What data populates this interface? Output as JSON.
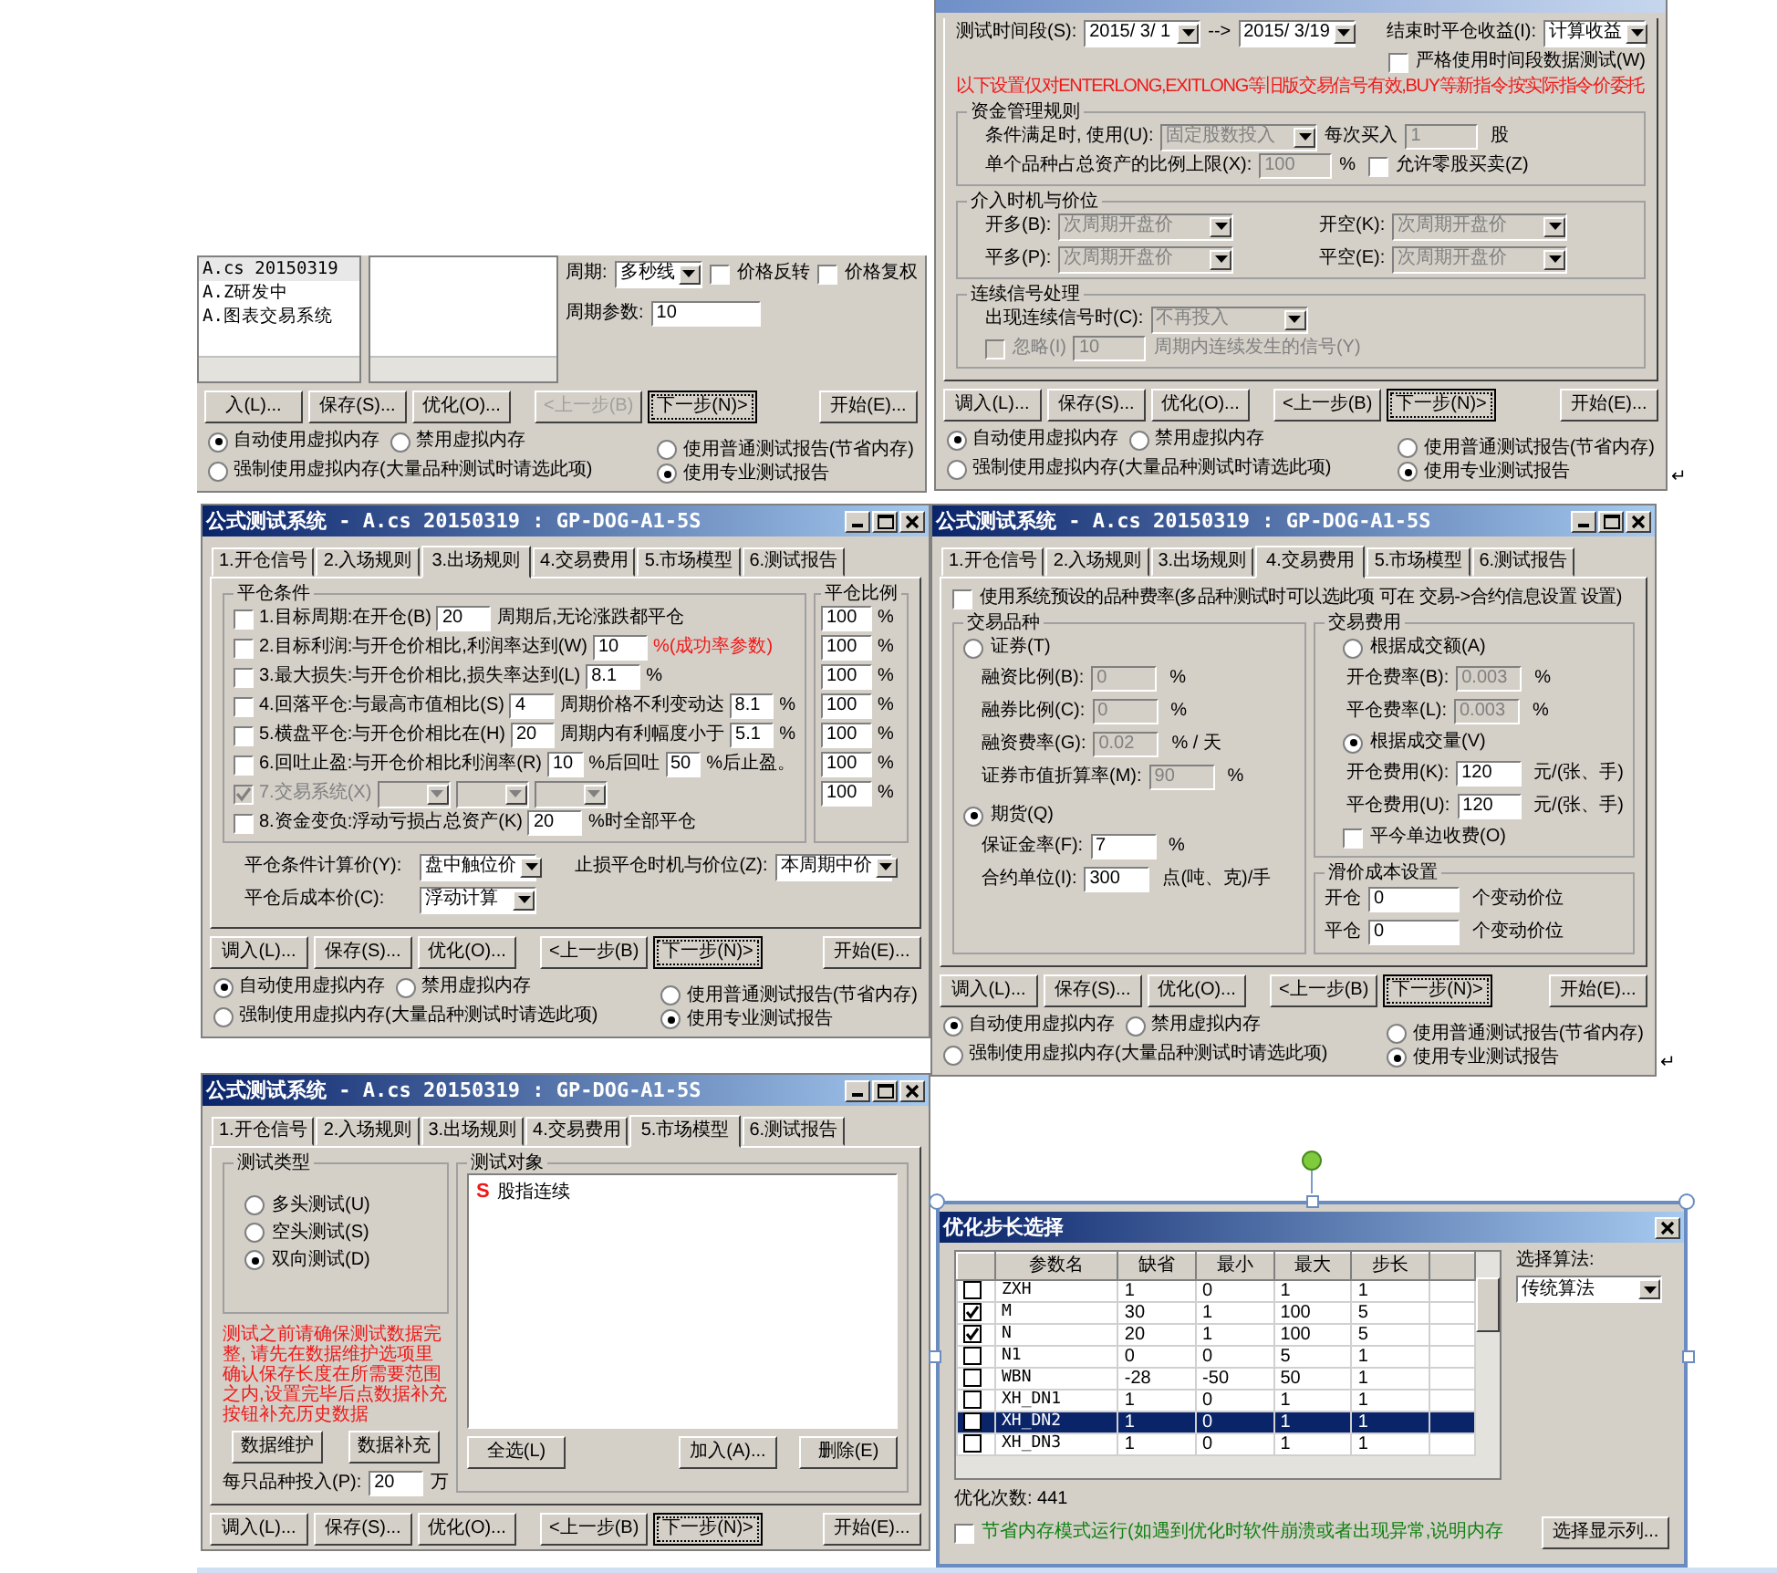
{
  "windows": [
    {
      "kind": "signal",
      "formula_list": [
        {
          "label": "A.cs 20150319",
          "selected": true
        },
        {
          "label": "A.Z研发中",
          "selected": false
        },
        {
          "label": "A.图表交易系统",
          "selected": false
        }
      ],
      "period": {
        "label": "周期:",
        "value": "多秒线"
      },
      "options": [
        {
          "label": "价格反转",
          "checked": false
        },
        {
          "label": "价格复权",
          "checked": false
        }
      ],
      "period_param": {
        "label": "周期参数:",
        "value": "10"
      },
      "buttons": [
        {
          "label": "入(L)...",
          "disabled": false,
          "focused": false
        },
        {
          "label": "保存(S)...",
          "disabled": false,
          "focused": false
        },
        {
          "label": "优化(O)...",
          "disabled": false,
          "focused": false
        },
        {
          "label": "<上一步(B)",
          "disabled": true,
          "focused": false
        },
        {
          "label": "下一步(N)>",
          "disabled": false,
          "focused": true
        },
        {
          "label": "开始(E)...",
          "disabled": false,
          "focused": false
        }
      ],
      "memory_options": [
        {
          "label": "自动使用虚拟内存",
          "selected": true
        },
        {
          "label": "禁用虚拟内存",
          "selected": false
        },
        {
          "label": "强制使用虚拟内存(大量品种测试时请选此项)",
          "selected": false
        }
      ],
      "report_options": [
        {
          "label": "使用普通测试报告(节省内存)",
          "selected": false
        },
        {
          "label": "使用专业测试报告",
          "selected": true
        }
      ]
    },
    {
      "kind": "entry",
      "test_period": {
        "label": "测试时间段(S):",
        "from": "2015/ 3/ 1",
        "separator": "-->",
        "to": "2015/ 3/19"
      },
      "close_profit": {
        "label": "结束时平仓收益(I):",
        "value": "计算收益"
      },
      "strict_option": {
        "label": "严格使用时间段数据测试(W)",
        "checked": false
      },
      "notice": "以下设置仅对ENTERLONG,EXITLONG等旧版交易信号有效,BUY等新指令按实际指令价委托",
      "money_rules": {
        "title": "资金管理规则",
        "disabled": true,
        "use_label": "条件满足时, 使用(U):",
        "use_value": "固定股数投入",
        "buy_label": "每次买入",
        "buy_value": "1",
        "buy_unit": "股",
        "ratio_label": "单个品种占总资产的比例上限(X):",
        "ratio_value": "100",
        "ratio_unit": "%",
        "odd_lot": {
          "label": "允许零股买卖(Z)",
          "checked": false
        }
      },
      "timing": {
        "title": "介入时机与价位",
        "disabled": true,
        "items": [
          {
            "label": "开多(B):",
            "value": "次周期开盘价"
          },
          {
            "label": "开空(K):",
            "value": "次周期开盘价"
          },
          {
            "label": "平多(P):",
            "value": "次周期开盘价"
          },
          {
            "label": "平空(E):",
            "value": "次周期开盘价"
          }
        ]
      },
      "consecutive": {
        "title": "连续信号处理",
        "disabled": true,
        "label": "出现连续信号时(C):",
        "value": "不再投入",
        "ignore": {
          "label": "忽略(I)",
          "checked": false
        },
        "periods": "10",
        "suffix": "周期内连续发生的信号(Y)"
      },
      "buttons": [
        {
          "label": "调入(L)...",
          "disabled": false,
          "focused": false
        },
        {
          "label": "保存(S)...",
          "disabled": false,
          "focused": false
        },
        {
          "label": "优化(O)...",
          "disabled": false,
          "focused": false
        },
        {
          "label": "<上一步(B)",
          "disabled": false,
          "focused": false
        },
        {
          "label": "下一步(N)>",
          "disabled": false,
          "focused": true
        },
        {
          "label": "开始(E)...",
          "disabled": false,
          "focused": false
        }
      ],
      "memory_options": [
        {
          "label": "自动使用虚拟内存",
          "selected": true
        },
        {
          "label": "禁用虚拟内存",
          "selected": false
        },
        {
          "label": "强制使用虚拟内存(大量品种测试时请选此项)",
          "selected": false
        }
      ],
      "report_options": [
        {
          "label": "使用普通测试报告(节省内存)",
          "selected": false
        },
        {
          "label": "使用专业测试报告",
          "selected": true
        }
      ],
      "end_mark": "↵"
    },
    {
      "kind": "exit",
      "title": "公式测试系统 - A.cs 20150319 : GP-DOG-A1-5S",
      "tabs": [
        {
          "label": "1.开仓信号",
          "selected": false
        },
        {
          "label": "2.入场规则",
          "selected": false
        },
        {
          "label": "3.出场规则",
          "selected": true
        },
        {
          "label": "4.交易费用",
          "selected": false
        },
        {
          "label": "5.市场模型",
          "selected": false
        },
        {
          "label": "6.测试报告",
          "selected": false
        }
      ],
      "close_conditions": {
        "title": "平仓条件",
        "rows": [
          {
            "checked": false,
            "disabled": false,
            "parts": [
              {
                "kind": "text",
                "text": "1.目标周期:在开仓(B)"
              },
              {
                "kind": "field",
                "value": "20"
              },
              {
                "kind": "text",
                "text": "周期后,无论涨跌都平仓"
              }
            ]
          },
          {
            "checked": false,
            "disabled": false,
            "parts": [
              {
                "kind": "text",
                "text": "2.目标利润:与开仓价相比,利润率达到(W)"
              },
              {
                "kind": "field",
                "value": "10"
              },
              {
                "kind": "warning",
                "text": "%(成功率参数)"
              }
            ]
          },
          {
            "checked": false,
            "disabled": false,
            "parts": [
              {
                "kind": "text",
                "text": "3.最大损失:与开仓价相比,损失率达到(L)"
              },
              {
                "kind": "field",
                "value": "8.1"
              },
              {
                "kind": "text",
                "text": "%"
              }
            ]
          },
          {
            "checked": false,
            "disabled": false,
            "parts": [
              {
                "kind": "text",
                "text": "4.回落平仓:与最高市值相比(S)"
              },
              {
                "kind": "field",
                "value": "4"
              },
              {
                "kind": "text",
                "text": "周期价格不利变动达"
              },
              {
                "kind": "field",
                "value": "8.1"
              },
              {
                "kind": "text",
                "text": "%"
              }
            ]
          },
          {
            "checked": false,
            "disabled": false,
            "parts": [
              {
                "kind": "text",
                "text": "5.横盘平仓:与开仓价相比在(H)"
              },
              {
                "kind": "field",
                "value": "20"
              },
              {
                "kind": "text",
                "text": "周期内有利幅度小于"
              },
              {
                "kind": "field",
                "value": "5.1"
              },
              {
                "kind": "text",
                "text": "%"
              }
            ]
          },
          {
            "checked": false,
            "disabled": false,
            "parts": [
              {
                "kind": "text",
                "text": "6.回吐止盈:与开仓价相比利润率(R)"
              },
              {
                "kind": "field",
                "value": "10"
              },
              {
                "kind": "text",
                "text": "%后回吐"
              },
              {
                "kind": "field",
                "value": "50"
              },
              {
                "kind": "text",
                "text": "%后止盈。"
              }
            ]
          },
          {
            "checked": true,
            "disabled": true,
            "parts": [
              {
                "kind": "text",
                "text": "7.交易系统(X)"
              },
              {
                "kind": "dropdown"
              },
              {
                "kind": "dropdown"
              },
              {
                "kind": "dropdown"
              }
            ]
          },
          {
            "checked": false,
            "disabled": false,
            "parts": [
              {
                "kind": "text",
                "text": "8.资金变负:浮动亏损占总资产(K)"
              },
              {
                "kind": "field",
                "value": "20"
              },
              {
                "kind": "text",
                "text": "%时全部平仓"
              }
            ]
          }
        ]
      },
      "close_ratio": {
        "title": "平仓比例",
        "items": [
          {
            "value": "100",
            "unit": "%"
          },
          {
            "value": "100",
            "unit": "%"
          },
          {
            "value": "100",
            "unit": "%"
          },
          {
            "value": "100",
            "unit": "%"
          },
          {
            "value": "100",
            "unit": "%"
          },
          {
            "value": "100",
            "unit": "%"
          },
          {
            "value": "100",
            "unit": "%"
          }
        ]
      },
      "price_settings": [
        {
          "label": "平仓条件计算价(Y):",
          "value": "盘中触位价"
        },
        {
          "label": "止损平仓时机与价位(Z):",
          "value": "本周期中价"
        },
        {
          "label": "平仓后成本价(C):",
          "value": "浮动计算"
        }
      ],
      "buttons": [
        {
          "label": "调入(L)...",
          "disabled": false,
          "focused": false
        },
        {
          "label": "保存(S)...",
          "disabled": false,
          "focused": false
        },
        {
          "label": "优化(O)...",
          "disabled": false,
          "focused": false
        },
        {
          "label": "<上一步(B)",
          "disabled": false,
          "focused": false
        },
        {
          "label": "下一步(N)>",
          "disabled": false,
          "focused": true
        },
        {
          "label": "开始(E)...",
          "disabled": false,
          "focused": false
        }
      ],
      "memory_options": [
        {
          "label": "自动使用虚拟内存",
          "selected": true
        },
        {
          "label": "禁用虚拟内存",
          "selected": false
        },
        {
          "label": "强制使用虚拟内存(大量品种测试时请选此项)",
          "selected": false
        }
      ],
      "report_options": [
        {
          "label": "使用普通测试报告(节省内存)",
          "selected": false
        },
        {
          "label": "使用专业测试报告",
          "selected": true
        }
      ]
    },
    {
      "kind": "fees",
      "title": "公式测试系统 - A.cs 20150319 : GP-DOG-A1-5S",
      "tabs": [
        {
          "label": "1.开仓信号",
          "selected": false
        },
        {
          "label": "2.入场规则",
          "selected": false
        },
        {
          "label": "3.出场规则",
          "selected": false
        },
        {
          "label": "4.交易费用",
          "selected": true
        },
        {
          "label": "5.市场模型",
          "selected": false
        },
        {
          "label": "6.测试报告",
          "selected": false
        }
      ],
      "preset_rate": {
        "label": "使用系统预设的品种费率(多品种测试时可以选此项 可在 交易->合约信息设置 设置)",
        "checked": false
      },
      "instrument": {
        "title": "交易品种",
        "groups": [
          {
            "label": "证券(T)",
            "selected": false,
            "rows": [
              {
                "label": "融资比例(B):",
                "value": "0",
                "unit": "%",
                "disabled": true
              },
              {
                "label": "融券比例(C):",
                "value": "0",
                "unit": "%",
                "disabled": true
              },
              {
                "label": "融资费率(G):",
                "value": "0.02",
                "unit": "% / 天",
                "disabled": true
              },
              {
                "label": "证券市值折算率(M):",
                "value": "90",
                "unit": "%",
                "disabled": true
              }
            ]
          },
          {
            "label": "期货(Q)",
            "selected": true,
            "rows": [
              {
                "label": "保证金率(F):",
                "value": "7",
                "unit": "%",
                "disabled": false
              },
              {
                "label": "合约单位(I):",
                "value": "300",
                "unit": "点(吨、克)/手",
                "disabled": false
              }
            ]
          }
        ]
      },
      "fees": {
        "title": "交易费用",
        "groups": [
          {
            "label": "根据成交额(A)",
            "selected": false,
            "rows": [
              {
                "label": "开仓费率(B):",
                "value": "0.003",
                "unit": "%",
                "disabled": true
              },
              {
                "label": "平仓费率(L):",
                "value": "0.003",
                "unit": "%",
                "disabled": true
              }
            ]
          },
          {
            "label": "根据成交量(V)",
            "selected": true,
            "rows": [
              {
                "label": "开仓费用(K):",
                "value": "120",
                "unit": "元/(张、手)",
                "disabled": false
              },
              {
                "label": "平仓费用(U):",
                "value": "120",
                "unit": "元/(张、手)",
                "disabled": false
              }
            ]
          }
        ],
        "same_day": {
          "label": "平今单边收费(O)",
          "checked": false
        }
      },
      "slippage": {
        "title": "滑价成本设置",
        "rows": [
          {
            "label": "开仓",
            "value": "0",
            "unit": "个变动价位"
          },
          {
            "label": "平仓",
            "value": "0",
            "unit": "个变动价位"
          }
        ]
      },
      "buttons": [
        {
          "label": "调入(L)...",
          "disabled": false,
          "focused": false
        },
        {
          "label": "保存(S)...",
          "disabled": false,
          "focused": false
        },
        {
          "label": "优化(O)...",
          "disabled": false,
          "focused": false
        },
        {
          "label": "<上一步(B)",
          "disabled": false,
          "focused": false
        },
        {
          "label": "下一步(N)>",
          "disabled": false,
          "focused": true
        },
        {
          "label": "开始(E)...",
          "disabled": false,
          "focused": false
        }
      ],
      "memory_options": [
        {
          "label": "自动使用虚拟内存",
          "selected": true
        },
        {
          "label": "禁用虚拟内存",
          "selected": false
        },
        {
          "label": "强制使用虚拟内存(大量品种测试时请选此项)",
          "selected": false
        }
      ],
      "report_options": [
        {
          "label": "使用普通测试报告(节省内存)",
          "selected": false
        },
        {
          "label": "使用专业测试报告",
          "selected": true
        }
      ],
      "end_mark": "↵"
    },
    {
      "kind": "market",
      "title": "公式测试系统 - A.cs 20150319 : GP-DOG-A1-5S",
      "tabs": [
        {
          "label": "1.开仓信号",
          "selected": false
        },
        {
          "label": "2.入场规则",
          "selected": false
        },
        {
          "label": "3.出场规则",
          "selected": false
        },
        {
          "label": "4.交易费用",
          "selected": false
        },
        {
          "label": "5.市场模型",
          "selected": true
        },
        {
          "label": "6.测试报告",
          "selected": false
        }
      ],
      "test_type": {
        "title": "测试类型",
        "options": [
          {
            "label": "多头测试(U)",
            "selected": false
          },
          {
            "label": "空头测试(S)",
            "selected": false
          },
          {
            "label": "双向测试(D)",
            "selected": true
          }
        ]
      },
      "notice": "测试之前请确保测试数据完整, 请先在数据维护选项里确认保存长度在所需要范围之内,设置完毕后点数据补充按钮补充历史数据",
      "data_buttons": [
        "数据维护",
        "数据补充"
      ],
      "investment": {
        "label": "每只品种投入(P):",
        "value": "20",
        "unit": "万"
      },
      "test_targets": {
        "title": "测试对象",
        "items": [
          {
            "mark": "S",
            "label": "股指连续"
          }
        ],
        "buttons": [
          "全选(L)",
          "加入(A)...",
          "删除(E)"
        ]
      },
      "buttons": [
        {
          "label": "调入(L)...",
          "disabled": false,
          "focused": false
        },
        {
          "label": "保存(S)...",
          "disabled": false,
          "focused": false
        },
        {
          "label": "优化(O)...",
          "disabled": false,
          "focused": false
        },
        {
          "label": "<上一步(B)",
          "disabled": false,
          "focused": false
        },
        {
          "label": "下一步(N)>",
          "disabled": false,
          "focused": true
        },
        {
          "label": "开始(E)...",
          "disabled": false,
          "focused": false
        }
      ]
    }
  ],
  "optimize_dialog": {
    "title": "优化步长选择",
    "columns": [
      "参数名",
      "缺省",
      "最小",
      "最大",
      "步长"
    ],
    "rows": [
      {
        "checked": false,
        "selected": false,
        "cells": [
          "ZXH",
          "1",
          "0",
          "1",
          "1"
        ]
      },
      {
        "checked": true,
        "selected": false,
        "cells": [
          "M",
          "30",
          "1",
          "100",
          "5"
        ]
      },
      {
        "checked": true,
        "selected": false,
        "cells": [
          "N",
          "20",
          "1",
          "100",
          "5"
        ]
      },
      {
        "checked": false,
        "selected": false,
        "cells": [
          "N1",
          "0",
          "0",
          "5",
          "1"
        ]
      },
      {
        "checked": false,
        "selected": false,
        "cells": [
          "WBN",
          "-28",
          "-50",
          "50",
          "1"
        ]
      },
      {
        "checked": false,
        "selected": false,
        "cells": [
          "XH_DN1",
          "1",
          "0",
          "1",
          "1"
        ]
      },
      {
        "checked": false,
        "selected": true,
        "cells": [
          "XH_DN2",
          "1",
          "0",
          "1",
          "1"
        ]
      },
      {
        "checked": false,
        "selected": false,
        "cells": [
          "XH_DN3",
          "1",
          "0",
          "1",
          "1"
        ]
      }
    ],
    "algorithm": {
      "label": "选择算法:",
      "value": "传统算法"
    },
    "count": "优化次数: 441",
    "columns_button": "选择显示列...",
    "memory_mode": {
      "label": "节省内存模式运行(如遇到优化时软件崩溃或者出现异常,说明内存",
      "checked": false
    }
  }
}
